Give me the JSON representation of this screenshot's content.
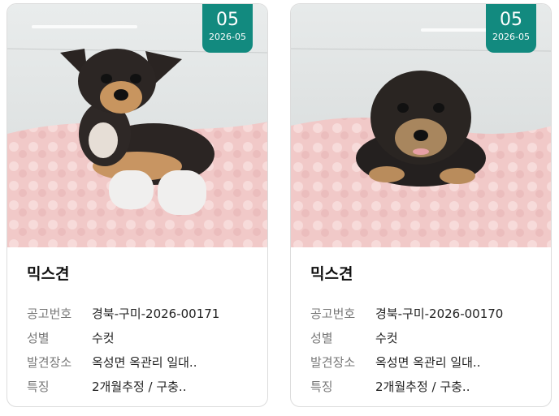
{
  "cards": [
    {
      "badge": {
        "day": "05",
        "year_month": "2026-05"
      },
      "breed": "믹스견",
      "fields": [
        {
          "label": "공고번호",
          "value": "경북-구미-2026-00171"
        },
        {
          "label": "성별",
          "value": "수컷"
        },
        {
          "label": "발견장소",
          "value": "옥성면 옥관리 일대.."
        },
        {
          "label": "특징",
          "value": "2개월추정 / 구충.."
        }
      ]
    },
    {
      "badge": {
        "day": "05",
        "year_month": "2026-05"
      },
      "breed": "믹스견",
      "fields": [
        {
          "label": "공고번호",
          "value": "경북-구미-2026-00170"
        },
        {
          "label": "성별",
          "value": "수컷"
        },
        {
          "label": "발견장소",
          "value": "옥성면 옥관리 일대.."
        },
        {
          "label": "특징",
          "value": "2개월추정 / 구충.."
        }
      ]
    }
  ],
  "colors": {
    "badge": "#128a7f",
    "blanket": "#f3cfcf"
  }
}
